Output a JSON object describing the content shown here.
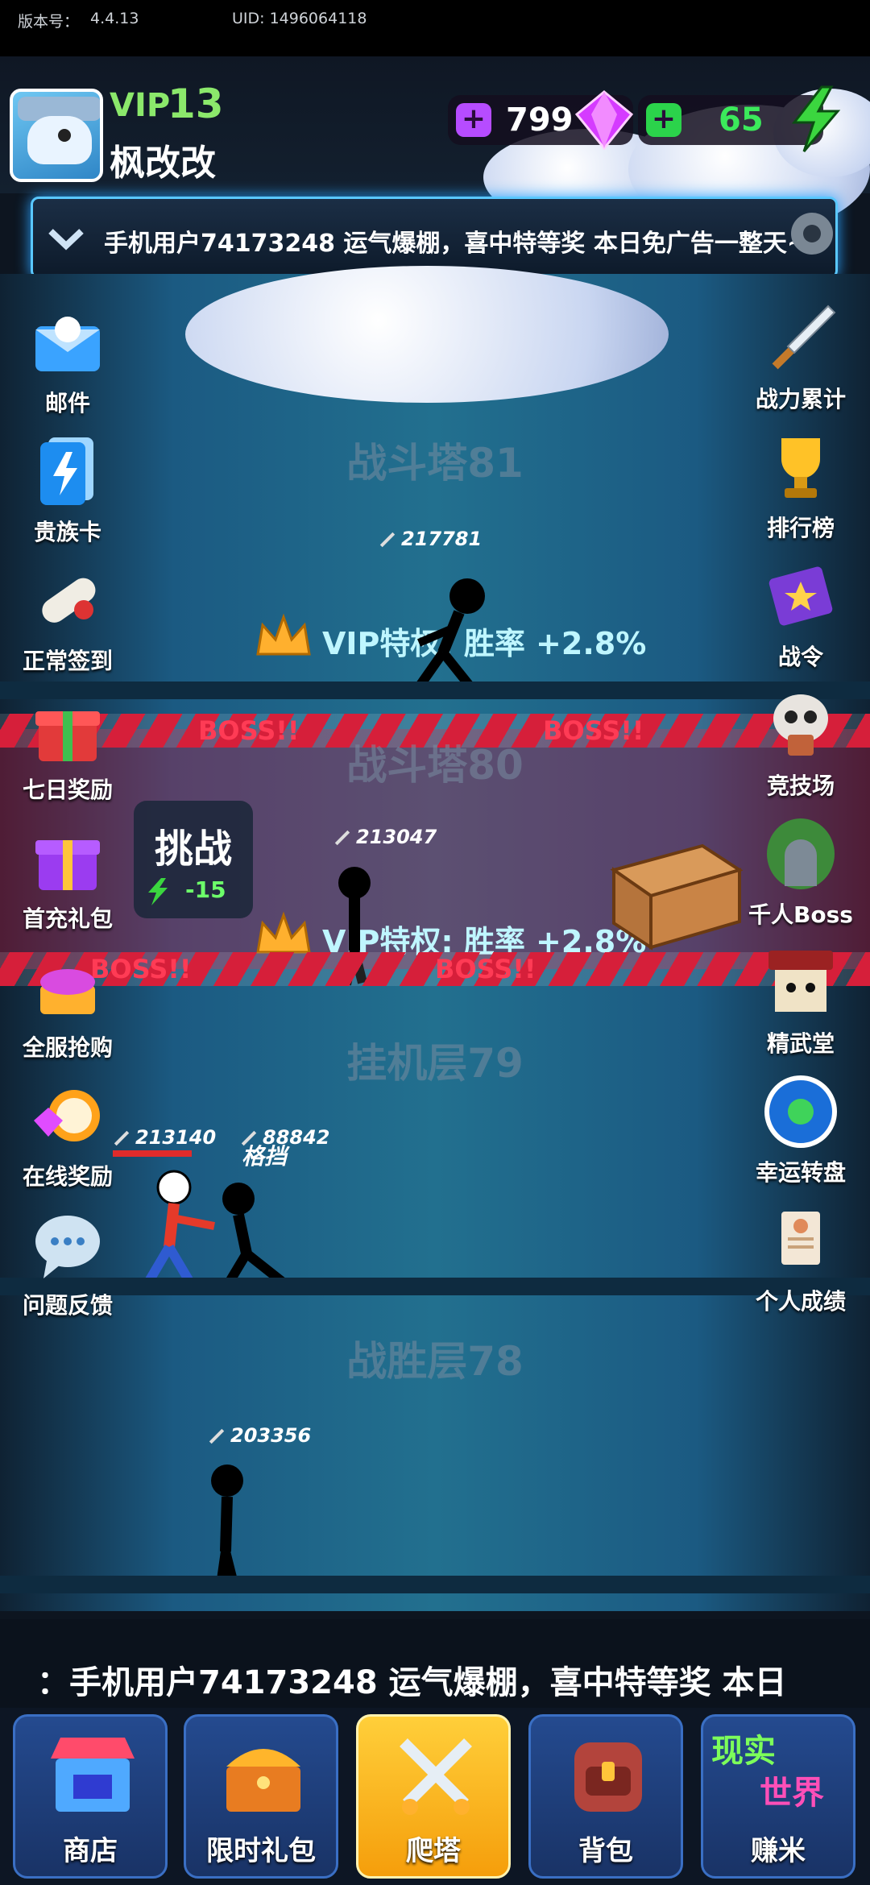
{
  "status": {
    "version_label": "版本号：",
    "version": "4.4.13",
    "uid": "UID: 1496064118"
  },
  "player": {
    "vip_label": "VIP",
    "vip_level": "13",
    "name": "枫改改"
  },
  "resources": {
    "gems": "799",
    "energy": "65"
  },
  "top_notice": "手机用户74173248 运气爆棚，喜中特等奖 本日免广告一整天~",
  "left_buttons": [
    {
      "label": "邮件",
      "icon": "mail-icon"
    },
    {
      "label": "贵族卡",
      "icon": "noble-card-icon"
    },
    {
      "label": "正常签到",
      "icon": "scroll-checkin-icon"
    },
    {
      "label": "七日奖励",
      "icon": "gift-icon"
    },
    {
      "label": "首充礼包",
      "icon": "purple-gift-icon"
    },
    {
      "label": "全服抢购",
      "icon": "treasure-icon"
    },
    {
      "label": "在线奖励",
      "icon": "clock-gem-icon"
    },
    {
      "label": "问题反馈",
      "icon": "chat-bubble-icon"
    }
  ],
  "right_buttons": [
    {
      "label": "战力累计",
      "icon": "sword-icon"
    },
    {
      "label": "排行榜",
      "icon": "trophy-icon"
    },
    {
      "label": "战令",
      "icon": "book-icon"
    },
    {
      "label": "竞技场",
      "icon": "skull-icon"
    },
    {
      "label": "千人Boss",
      "icon": "cave-door-icon"
    },
    {
      "label": "精武堂",
      "icon": "dojo-icon"
    },
    {
      "label": "幸运转盘",
      "icon": "wheel-icon"
    },
    {
      "label": "个人成绩",
      "icon": "report-icon"
    }
  ],
  "floors": [
    {
      "title": "战斗塔81",
      "power": "217781",
      "perk": "VIP特权: 胜率 +2.8%"
    },
    {
      "title": "战斗塔80",
      "power": "213047",
      "perk": "VIP特权: 胜率 +2.8%",
      "boss": "BOSS!!"
    },
    {
      "title": "挂机层79",
      "player_power": "213140",
      "enemy_power": "88842",
      "block": "格挡"
    },
    {
      "title": "战胜层78",
      "power": "203356"
    }
  ],
  "challenge": {
    "label": "挑战",
    "cost": "-15"
  },
  "bottom_notice": "：手机用户74173248 运气爆棚，喜中特等奖 本日",
  "tabs": [
    {
      "label": "商店",
      "icon": "shop-icon"
    },
    {
      "label": "限时礼包",
      "icon": "chest-icon"
    },
    {
      "label": "爬塔",
      "icon": "crossed-swords-icon",
      "active": true
    },
    {
      "label": "背包",
      "icon": "backpack-icon"
    },
    {
      "label": "赚米",
      "icon": "real-world-icon",
      "badge_line1": "现实",
      "badge_line2": "世界"
    }
  ],
  "colors": {
    "vip_green": "#8be86b",
    "gem_purple": "#c23bff",
    "energy_green": "#2bd34b",
    "boss_red": "#ff3b55",
    "tab_active": "#f59e0b"
  }
}
